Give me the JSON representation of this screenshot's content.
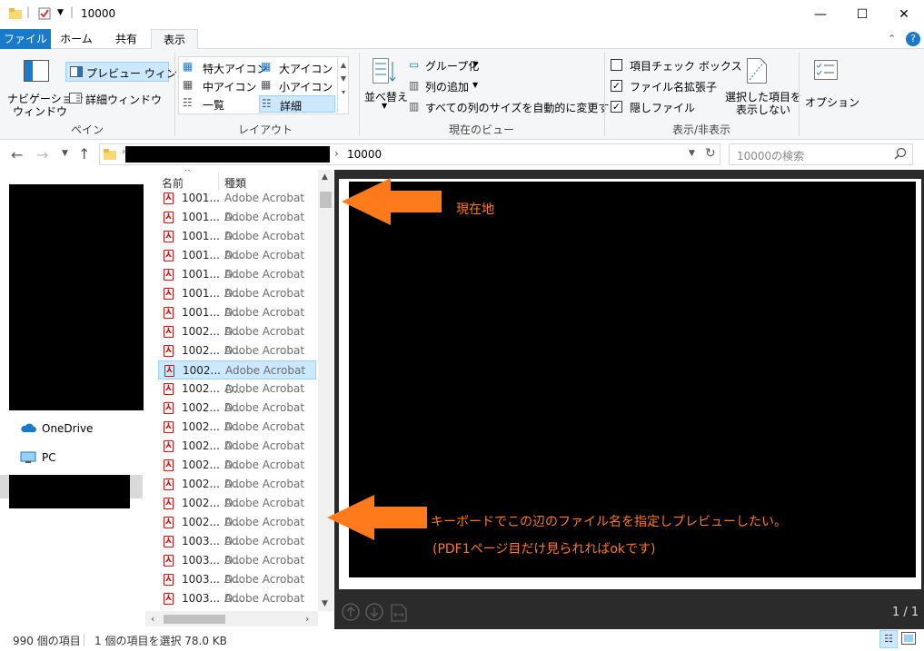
{
  "window": {
    "title": "10000"
  },
  "ribbon_tabs": {
    "file": "ファイル",
    "home": "ホーム",
    "share": "共有",
    "view": "表示"
  },
  "ribbon": {
    "pane": {
      "nav": "ナビゲーション",
      "nav2": "ウィンドウ",
      "preview": "プレビュー ウィンドウ",
      "details": "詳細ウィンドウ",
      "group": "ペイン"
    },
    "layout": {
      "xl": "特大アイコン",
      "l": "大アイコン",
      "m": "中アイコン",
      "s": "小アイコン",
      "list": "一覧",
      "details": "詳細",
      "group": "レイアウト"
    },
    "view": {
      "sort": "並べ替え",
      "groupby": "グループ化",
      "addcol": "列の追加",
      "fitcols": "すべての列のサイズを自動的に変更する",
      "group": "現在のビュー"
    },
    "showhide": {
      "chk_items": "項目チェック ボックス",
      "chk_ext": "ファイル名拡張子",
      "chk_hidden": "隠しファイル",
      "hide_sel": "選択した項目を",
      "hide_sel2": "表示しない",
      "group": "表示/非表示"
    },
    "options": "オプション"
  },
  "address": {
    "path_last": "10000",
    "search_placeholder": "10000の検索"
  },
  "nav": {
    "onedrive": "OneDrive",
    "pc": "PC"
  },
  "list": {
    "col_name": "名前",
    "col_type": "種類",
    "rows": [
      {
        "name": "1001...",
        "type": "Adobe Acrobat D..."
      },
      {
        "name": "1001...",
        "type": "Adobe Acrobat D..."
      },
      {
        "name": "1001...",
        "type": "Adobe Acrobat D..."
      },
      {
        "name": "1001...",
        "type": "Adobe Acrobat D..."
      },
      {
        "name": "1001...",
        "type": "Adobe Acrobat D..."
      },
      {
        "name": "1001...",
        "type": "Adobe Acrobat D..."
      },
      {
        "name": "1001...",
        "type": "Adobe Acrobat D..."
      },
      {
        "name": "1002...",
        "type": "Adobe Acrobat D..."
      },
      {
        "name": "1002...",
        "type": "Adobe Acrobat D..."
      },
      {
        "name": "1002...",
        "type": "Adobe Acrobat D..."
      },
      {
        "name": "1002...",
        "type": "Adobe Acrobat D..."
      },
      {
        "name": "1002...",
        "type": "Adobe Acrobat D..."
      },
      {
        "name": "1002...",
        "type": "Adobe Acrobat D..."
      },
      {
        "name": "1002...",
        "type": "Adobe Acrobat D..."
      },
      {
        "name": "1002...",
        "type": "Adobe Acrobat D..."
      },
      {
        "name": "1002...",
        "type": "Adobe Acrobat D..."
      },
      {
        "name": "1002...",
        "type": "Adobe Acrobat D..."
      },
      {
        "name": "1002...",
        "type": "Adobe Acrobat D..."
      },
      {
        "name": "1003...",
        "type": "Adobe Acrobat D..."
      },
      {
        "name": "1003...",
        "type": "Adobe Acrobat D..."
      },
      {
        "name": "1003...",
        "type": "Adobe Acrobat D..."
      },
      {
        "name": "1003...",
        "type": "Adobe Acrobat D..."
      },
      {
        "name": "1003...",
        "type": "Adobe Acrobat D..."
      }
    ],
    "selected_index": 9
  },
  "preview": {
    "page_counter": "1 / 1"
  },
  "annotations": {
    "current": "現在地",
    "want1": "キーボードでこの辺のファイル名を指定しプレビューしたい。",
    "want2": "(PDF1ページ目だけ見られればokです)"
  },
  "status": {
    "count": "990 個の項目",
    "selected": "1 個の項目を選択  78.0 KB"
  },
  "colors": {
    "accent": "#1979ca",
    "annotation": "#ff7a1a"
  }
}
